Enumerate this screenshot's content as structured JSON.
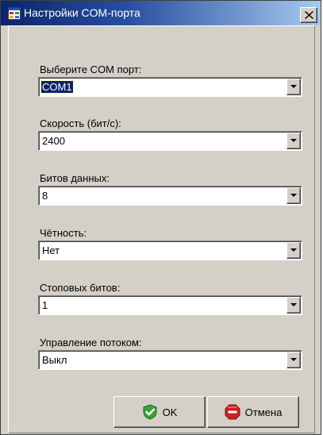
{
  "window": {
    "title": "Настройки COM-порта"
  },
  "fields": [
    {
      "label": "Выберите COM порт:",
      "value": "COM1"
    },
    {
      "label": "Скорость (бит/с):",
      "value": "2400"
    },
    {
      "label": "Битов данных:",
      "value": "8"
    },
    {
      "label": "Чётность:",
      "value": "Нет"
    },
    {
      "label": "Стоповых битов:",
      "value": "1"
    },
    {
      "label": "Управление потоком:",
      "value": "Выкл"
    }
  ],
  "buttons": {
    "ok_label": "OK",
    "cancel_label": "Отмена"
  },
  "icons": {
    "title": "app-window-icon",
    "close": "close-icon",
    "dropdown": "chevron-down-icon",
    "ok": "check-shield-icon",
    "cancel": "stop-icon"
  },
  "colors": {
    "titlebar": "#0a246a",
    "face": "#d4d0c8",
    "selection": "#0a246a",
    "ok_icon": "#3aa335",
    "cancel_icon": "#cc2222"
  }
}
